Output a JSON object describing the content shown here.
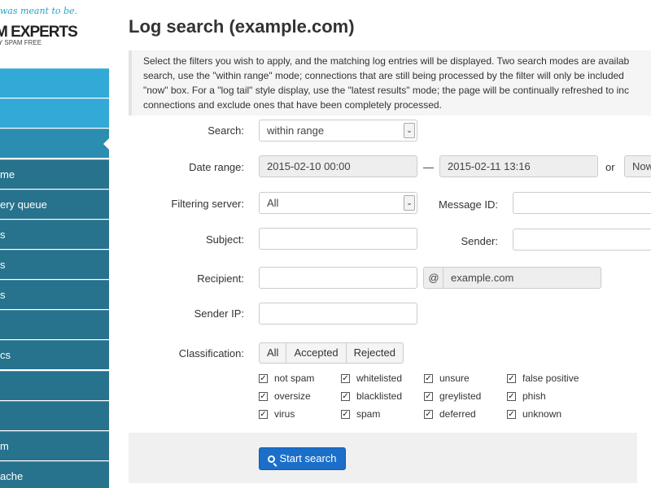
{
  "logo": {
    "tagline": "I was meant to be.",
    "brand": "M EXPERTS",
    "sub": "Y SPAM FREE"
  },
  "sidebar": {
    "items": [
      {
        "label": ""
      },
      {
        "label": ""
      },
      {
        "label": ""
      },
      {
        "label": "me"
      },
      {
        "label": "ery queue"
      },
      {
        "label": "s"
      },
      {
        "label": "s"
      },
      {
        "label": "s"
      },
      {
        "label": ""
      },
      {
        "label": "cs"
      },
      {
        "label": ""
      },
      {
        "label": ""
      },
      {
        "label": "m"
      },
      {
        "label": "ache"
      }
    ]
  },
  "page": {
    "title": "Log search (example.com)",
    "intro": [
      "Select the filters you wish to apply, and the matching log entries will be displayed. Two search modes are availab",
      "search, use the \"within range\" mode; connections that are still being processed by the filter will only be included",
      "\"now\" box. For a \"log tail\" style display, use the \"latest results\" mode; the page will be continually refreshed to inc",
      "connections and exclude ones that have been completely processed."
    ]
  },
  "form": {
    "search_label": "Search:",
    "search_value": "within range",
    "date_label": "Date range:",
    "date_from": "2015-02-10 00:00",
    "date_dash": "—",
    "date_to": "2015-02-11 13:16",
    "date_or": "or",
    "date_now": "Now",
    "server_label": "Filtering server:",
    "server_value": "All",
    "msgid_label": "Message ID:",
    "subject_label": "Subject:",
    "sender_label": "Sender:",
    "recipient_label": "Recipient:",
    "at_symbol": "@",
    "recipient_domain": "example.com",
    "senderip_label": "Sender IP:",
    "class_label": "Classification:",
    "class_buttons": [
      "All",
      "Accepted",
      "Rejected"
    ],
    "checkboxes": [
      "not spam",
      "whitelisted",
      "unsure",
      "false positive",
      "oversize",
      "blacklisted",
      "greylisted",
      "phish",
      "virus",
      "spam",
      "deferred",
      "unknown"
    ],
    "start_button": "Start search"
  }
}
